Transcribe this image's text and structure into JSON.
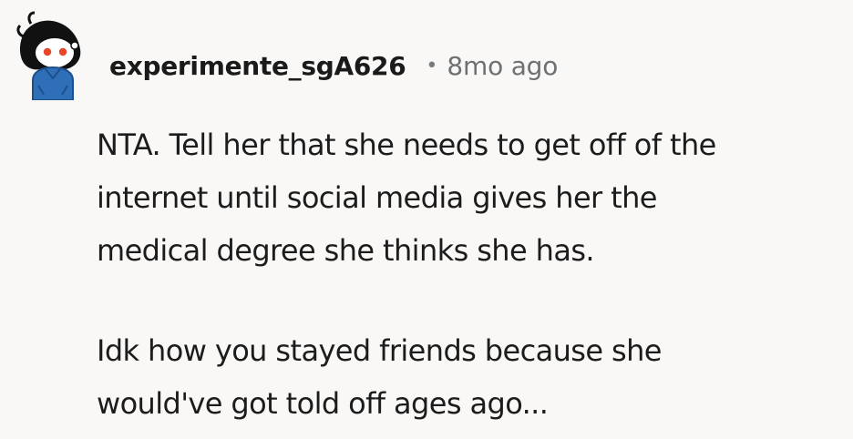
{
  "comment": {
    "avatar_icon": "snoo-avatar-icon",
    "username": "experimente_sgA626",
    "separator": "•",
    "timestamp": "8mo ago",
    "paragraphs": [
      {
        "lines": [
          "NTA. Tell her that she needs to get off of the",
          "internet until social media gives her the",
          "medical degree she thinks she has."
        ]
      },
      {
        "lines": [
          "Idk how you stayed friends because she",
          "would've got told off ages ago..."
        ]
      }
    ]
  },
  "colors": {
    "background": "#f9f8f7",
    "text": "#1c1c1c",
    "meta": "#6e7072",
    "avatar_shirt": "#2f6fb8",
    "avatar_eye": "#e8452a"
  }
}
